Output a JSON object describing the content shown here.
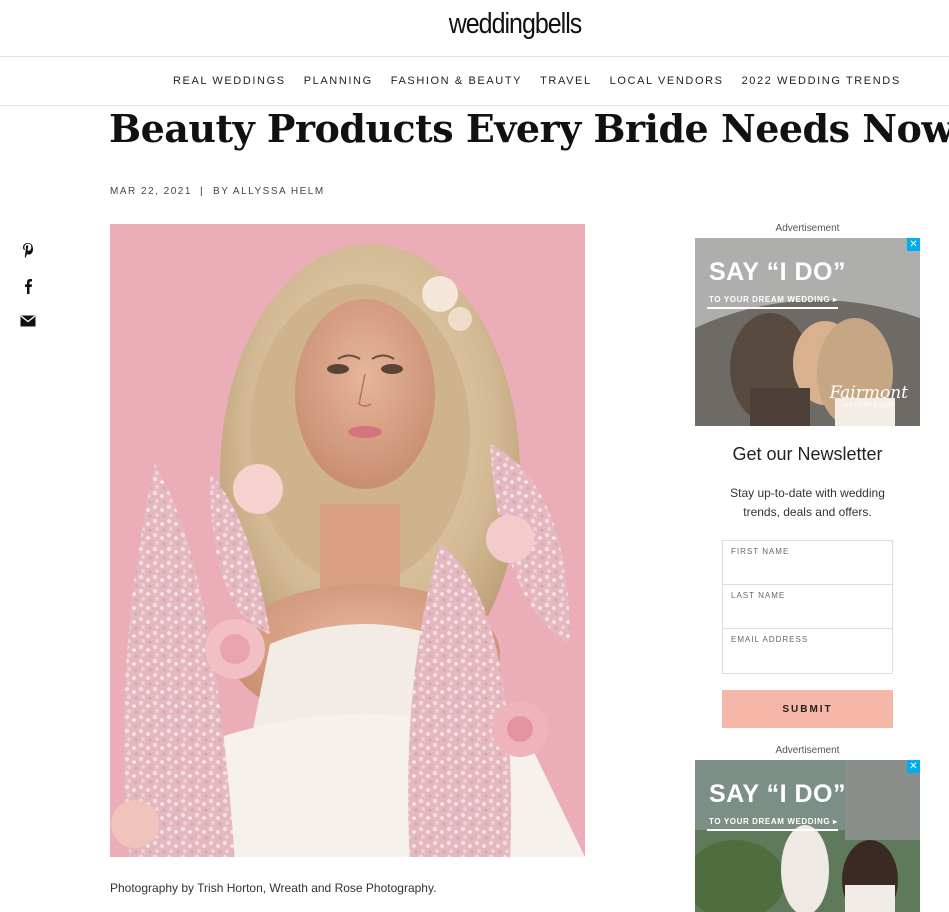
{
  "site": {
    "logo": "weddingbells"
  },
  "nav": [
    "REAL WEDDINGS",
    "PLANNING",
    "FASHION & BEAUTY",
    "TRAVEL",
    "LOCAL VENDORS",
    "2022 WEDDING TRENDS"
  ],
  "article": {
    "title": "Beauty Products Every Bride Needs Now",
    "date": "MAR 22, 2021",
    "separator": "|",
    "byline": "BY ALLYSSA HELM",
    "caption": "Photography by Trish Horton, Wreath and Rose Photography."
  },
  "share": {
    "icons": [
      "pinterest-icon",
      "facebook-icon",
      "email-icon"
    ]
  },
  "ads": [
    {
      "label": "Advertisement",
      "headline": "SAY “I DO”",
      "sub": "TO YOUR DREAM WEDDING ▸",
      "brand": "Fairmont",
      "brand_sub": "WATERFRONT",
      "close": "✕"
    },
    {
      "label": "Advertisement",
      "headline": "SAY “I DO”",
      "sub": "TO YOUR DREAM WEDDING ▸",
      "close": "✕"
    }
  ],
  "newsletter": {
    "title": "Get our Newsletter",
    "text": "Stay up-to-date with wedding trends, deals and offers.",
    "fields": [
      {
        "label": "FIRST NAME",
        "value": ""
      },
      {
        "label": "LAST NAME",
        "value": ""
      },
      {
        "label": "EMAIL ADDRESS",
        "value": ""
      }
    ],
    "submit": "SUBMIT"
  },
  "colors": {
    "submit_bg": "#f6b6a8",
    "ad_close": "#00aeef",
    "photo_backdrop": "#e8a9b4"
  }
}
